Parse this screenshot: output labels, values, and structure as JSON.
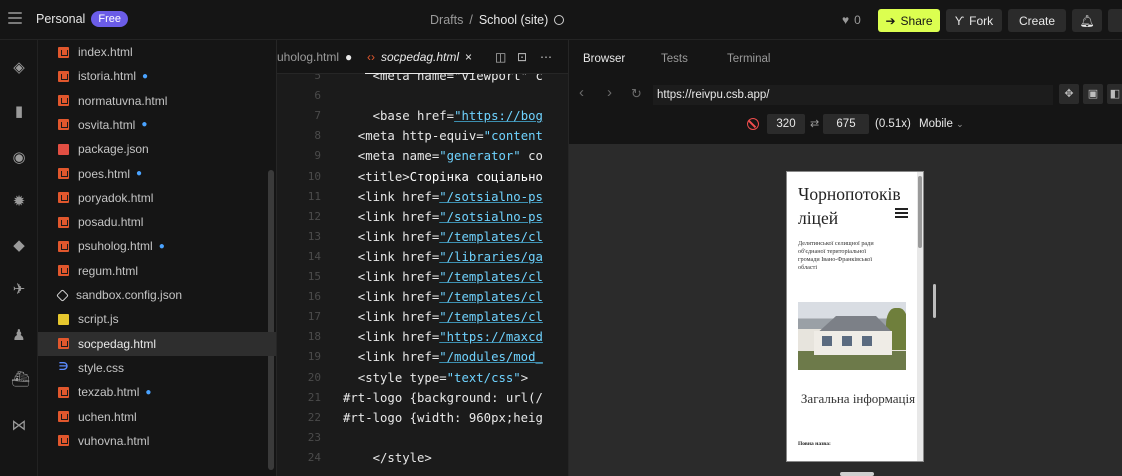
{
  "topbar": {
    "workspace": "Personal",
    "plan_badge": "Free",
    "crumb_parent": "Drafts",
    "crumb_sep": "/",
    "project_name": "School (site)",
    "likes": "0",
    "share_label": "Share",
    "fork_label": "Fork",
    "create_label": "Create"
  },
  "files": [
    {
      "name": "index.html",
      "type": "html",
      "modified": false
    },
    {
      "name": "istoria.html",
      "type": "html",
      "modified": true
    },
    {
      "name": "normatuvna.html",
      "type": "html",
      "modified": false
    },
    {
      "name": "osvita.html",
      "type": "html",
      "modified": true
    },
    {
      "name": "package.json",
      "type": "json",
      "modified": false
    },
    {
      "name": "poes.html",
      "type": "html",
      "modified": true
    },
    {
      "name": "poryadok.html",
      "type": "html",
      "modified": false
    },
    {
      "name": "posadu.html",
      "type": "html",
      "modified": false
    },
    {
      "name": "psuholog.html",
      "type": "html",
      "modified": true
    },
    {
      "name": "regum.html",
      "type": "html",
      "modified": false
    },
    {
      "name": "sandbox.config.json",
      "type": "cfg",
      "modified": false
    },
    {
      "name": "script.js",
      "type": "js",
      "modified": false
    },
    {
      "name": "socpedag.html",
      "type": "html",
      "modified": false,
      "active": true
    },
    {
      "name": "style.css",
      "type": "css",
      "modified": false
    },
    {
      "name": "texzab.html",
      "type": "html",
      "modified": true
    },
    {
      "name": "uchen.html",
      "type": "html",
      "modified": false
    },
    {
      "name": "vuhovna.html",
      "type": "html",
      "modified": false
    }
  ],
  "editor": {
    "tab_inactive": "uholog.html",
    "tab_active": "socpedag.html",
    "lines": [
      {
        "n": "5",
        "segments": [
          {
            "t": "    <meta name=\"viewport\" c",
            "c": "tag"
          }
        ]
      },
      {
        "n": "6",
        "segments": []
      },
      {
        "n": "7",
        "segments": [
          {
            "t": "    <base href=",
            "c": "tag"
          },
          {
            "t": "\"https://bog",
            "c": "str"
          }
        ]
      },
      {
        "n": "8",
        "segments": [
          {
            "t": "  <meta http-equiv=",
            "c": "tag"
          },
          {
            "t": "\"content",
            "c": "strplain"
          }
        ]
      },
      {
        "n": "9",
        "segments": [
          {
            "t": "  <meta name=",
            "c": "tag"
          },
          {
            "t": "\"generator\"",
            "c": "strplain"
          },
          {
            "t": " co",
            "c": "tag"
          }
        ]
      },
      {
        "n": "10",
        "segments": [
          {
            "t": "  <title>",
            "c": "tag"
          },
          {
            "t": "Сторінка соціально",
            "c": "title-text"
          }
        ]
      },
      {
        "n": "11",
        "segments": [
          {
            "t": "  <link href=",
            "c": "tag"
          },
          {
            "t": "\"/sotsialno-ps",
            "c": "str"
          }
        ]
      },
      {
        "n": "12",
        "segments": [
          {
            "t": "  <link href=",
            "c": "tag"
          },
          {
            "t": "\"/sotsialno-ps",
            "c": "str"
          }
        ]
      },
      {
        "n": "13",
        "segments": [
          {
            "t": "  <link href=",
            "c": "tag"
          },
          {
            "t": "\"/templates/cl",
            "c": "str"
          }
        ]
      },
      {
        "n": "14",
        "segments": [
          {
            "t": "  <link href=",
            "c": "tag"
          },
          {
            "t": "\"/libraries/ga",
            "c": "str"
          }
        ]
      },
      {
        "n": "15",
        "segments": [
          {
            "t": "  <link href=",
            "c": "tag"
          },
          {
            "t": "\"/templates/cl",
            "c": "str"
          }
        ]
      },
      {
        "n": "16",
        "segments": [
          {
            "t": "  <link href=",
            "c": "tag"
          },
          {
            "t": "\"/templates/cl",
            "c": "str"
          }
        ]
      },
      {
        "n": "17",
        "segments": [
          {
            "t": "  <link href=",
            "c": "tag"
          },
          {
            "t": "\"/templates/cl",
            "c": "str"
          }
        ]
      },
      {
        "n": "18",
        "segments": [
          {
            "t": "  <link href=",
            "c": "tag"
          },
          {
            "t": "\"https://maxcd",
            "c": "str"
          }
        ]
      },
      {
        "n": "19",
        "segments": [
          {
            "t": "  <link href=",
            "c": "tag"
          },
          {
            "t": "\"/modules/mod_",
            "c": "str"
          }
        ]
      },
      {
        "n": "20",
        "segments": [
          {
            "t": "  <style type=",
            "c": "tag"
          },
          {
            "t": "\"text/css\"",
            "c": "strplain"
          },
          {
            "t": ">",
            "c": "tag"
          }
        ]
      },
      {
        "n": "21",
        "segments": [
          {
            "t": "#rt-logo {background: url(/",
            "c": "css-sel"
          }
        ]
      },
      {
        "n": "22",
        "segments": [
          {
            "t": "#rt-logo {width: 960px;heig",
            "c": "css-sel"
          }
        ]
      },
      {
        "n": "23",
        "segments": []
      },
      {
        "n": "24",
        "segments": [
          {
            "t": "    </style>",
            "c": "tag"
          }
        ]
      }
    ]
  },
  "browser": {
    "tab_browser": "Browser",
    "tab_tests": "Tests",
    "tab_terminal": "Terminal",
    "url": "https://reivpu.csb.app/",
    "width": "320",
    "height": "675",
    "scale": "(0.51x)",
    "mode": "Mobile",
    "page": {
      "site_name": "Чорнопотоків ліцей",
      "subtitle": "Делятинської селищної ради об'єднаної територіальної громади Івано-Франківської області",
      "section_title": "Загальна інформація",
      "full_name_label": "Повна назва:"
    }
  },
  "colors": {
    "accent_share": "#dcff50",
    "badge": "#6b5ce7",
    "modified_dot": "#4aa3ff",
    "string": "#6fd3ff"
  }
}
